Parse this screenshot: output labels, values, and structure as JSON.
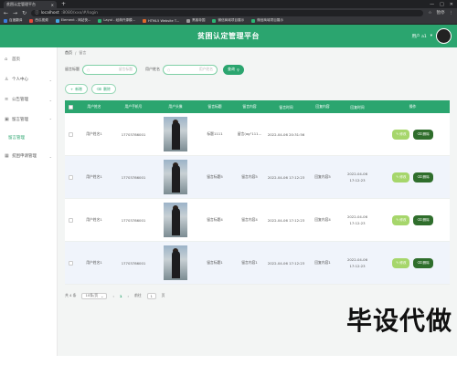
{
  "browser": {
    "tab_title": "贫困认定管理平台",
    "url_host": "localhost",
    "url_path": ":8080/xxx/#/login",
    "bookmarks": [
      "百度翻译",
      "西瓜视频",
      "Element - 网站快...",
      "Layui - 经典开源模...",
      "HTML5 Website T...",
      "黑客帝国",
      "微信商城项目展示",
      "微信商城项目展示"
    ],
    "profile": "暂停",
    "window_controls": [
      "—",
      "□",
      "✕"
    ]
  },
  "header": {
    "title": "贫困认定管理平台",
    "user_label": "用户 a1"
  },
  "sidebar": {
    "items": [
      {
        "label": "首页",
        "icon": "home-icon"
      },
      {
        "label": "个人中心",
        "icon": "user-icon"
      },
      {
        "label": "公告管理",
        "icon": "list-icon"
      },
      {
        "label": "留言管理",
        "icon": "message-icon",
        "expanded": true
      },
      {
        "label": "留言管理",
        "sub": true
      },
      {
        "label": "贫困申请管理",
        "icon": "grid-icon"
      }
    ]
  },
  "breadcrumb": {
    "home": "首页",
    "sep": "/",
    "current": "留言"
  },
  "search": {
    "title_label": "留言标题",
    "title_placeholder": "留言标题",
    "name_label": "用户姓名",
    "name_placeholder": "用户姓名",
    "query_button": "查询"
  },
  "actions": {
    "add": "新增",
    "delete": "删除"
  },
  "table": {
    "headers": [
      "用户姓名",
      "用户手机号",
      "用户头像",
      "留言标题",
      "留言内容",
      "留言时间",
      "回复内容",
      "回复时间",
      "操作"
    ],
    "rows": [
      {
        "name": "用户姓名1",
        "phone": "17703786001",
        "title": "标题1111",
        "content": "留言(ag\"111...",
        "time": "2022-04-06 20:31:56",
        "reply": "",
        "reply_time": ""
      },
      {
        "name": "用户姓名1",
        "phone": "17703786001",
        "title": "留言标题5",
        "content": "留言内容5",
        "time": "2022-04-06 17:12:23",
        "reply": "回复内容5",
        "reply_time": "2022-04-06 17:12:23"
      },
      {
        "name": "用户姓名1",
        "phone": "17703786001",
        "title": "留言标题4",
        "content": "留言内容4",
        "time": "2022-04-06 17:12:23",
        "reply": "回复内容4",
        "reply_time": "2022-04-06 17:12:23"
      },
      {
        "name": "用户姓名1",
        "phone": "17703786001",
        "title": "留言标题1",
        "content": "留言内容1",
        "time": "2022-04-06 17:12:23",
        "reply": "回复内容1",
        "reply_time": "2022-04-06 17:12:23"
      }
    ],
    "edit_label": "修改",
    "delete_label": "删除"
  },
  "pager": {
    "total": "共 4 条",
    "page_size": "10条/页",
    "current_page": "1",
    "goto_label": "前往",
    "goto_value": "1",
    "page_unit": "页"
  },
  "watermark": "毕设代做",
  "colors": {
    "primary": "#2ba56f",
    "edit": "#a6d66b",
    "delete": "#2f6e2c"
  }
}
